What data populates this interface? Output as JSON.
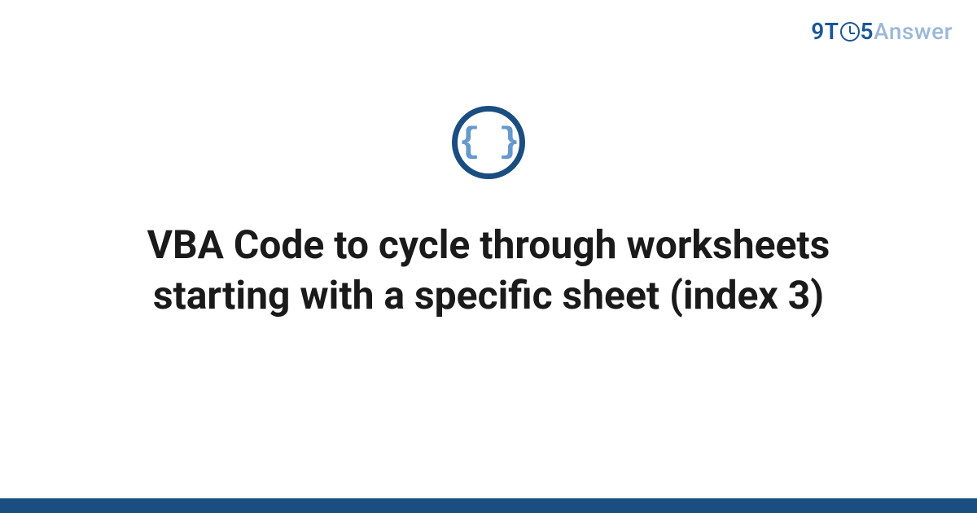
{
  "brand": {
    "nine": "9",
    "t": "T",
    "five": "5",
    "answer": "Answer"
  },
  "icon": {
    "braces": "{ }",
    "name": "code-braces-icon"
  },
  "title": "VBA Code to cycle through worksheets starting with a specific sheet (index 3)",
  "colors": {
    "brand_primary": "#1a5599",
    "brand_light": "#9bb8d8",
    "icon_border": "#1a4d80",
    "braces": "#6699cc",
    "footer": "#1a4d80"
  }
}
